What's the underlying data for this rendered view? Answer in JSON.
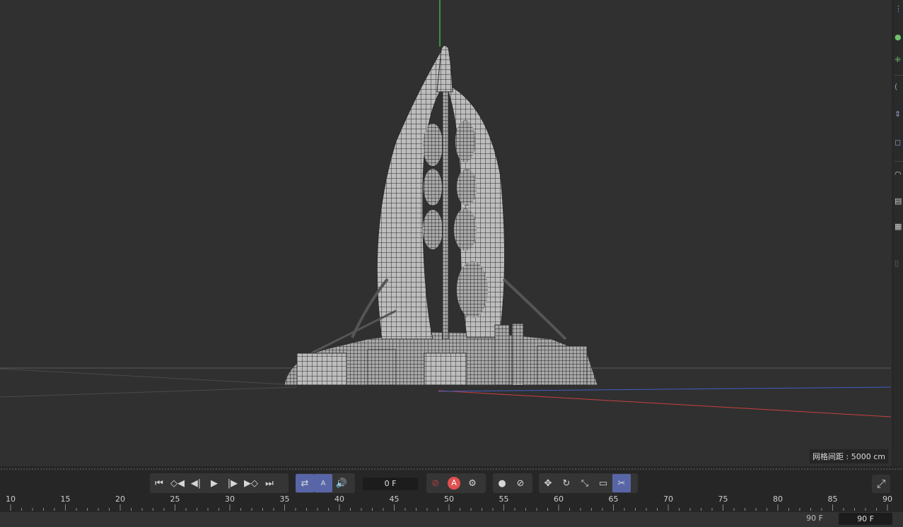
{
  "viewport": {
    "grid_spacing_label": "网格间距 : 5000 cm",
    "object_icon": "tower-mesh-icon"
  },
  "right_toolbar": {
    "tools": [
      "move-tool-icon",
      "points-mode-icon",
      "edges-mode-icon",
      "polygons-mode-icon",
      "scale-icon",
      "rotate-icon",
      "snap-icon",
      "workplane-icon",
      "axis-icon",
      "render-icon"
    ]
  },
  "playback": {
    "buttons": [
      "go-to-start-icon",
      "prev-keyframe-icon",
      "prev-frame-icon",
      "play-icon",
      "next-frame-icon",
      "next-keyframe-icon",
      "go-to-end-icon"
    ],
    "loop_icon": "loop-icon",
    "autokey_label": "A",
    "sound_icon": "sound-icon",
    "current_frame": "0 F",
    "record_autokey_label": "A",
    "end_frame": "90 F",
    "end_frame_field": "90 F"
  },
  "ruler": {
    "labels": [
      "10",
      "15",
      "20",
      "25",
      "30",
      "35",
      "40",
      "45",
      "50",
      "55",
      "60",
      "65",
      "70",
      "75",
      "80",
      "85",
      "90"
    ]
  },
  "colors": {
    "viewport_bg": "#303030",
    "accent": "#5866a8",
    "record_red": "#e05050"
  }
}
